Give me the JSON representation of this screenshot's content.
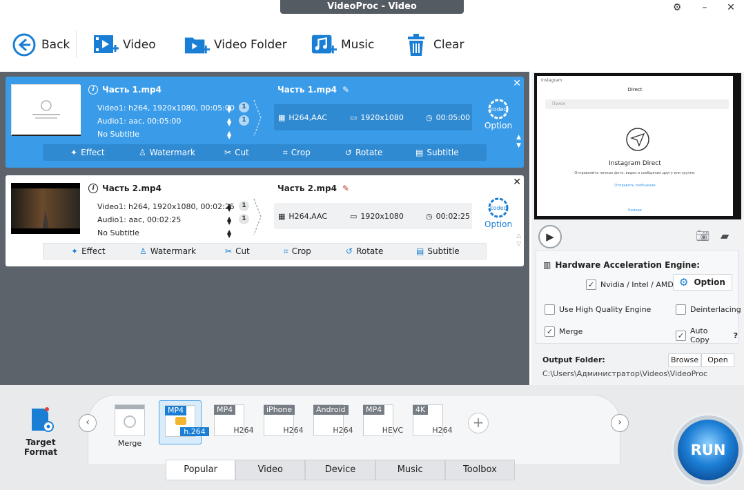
{
  "window": {
    "title": "VideoProc - Video"
  },
  "toolbar": {
    "back": "Back",
    "video": "Video",
    "video_folder": "Video Folder",
    "music": "Music",
    "clear": "Clear"
  },
  "items": [
    {
      "name": "Часть 1.mp4",
      "video_track": "Video1: h264, 1920x1080, 00:05:00",
      "audio_track": "Audio1: aac, 00:05:00",
      "subtitle": "No Subtitle",
      "video_count": "1",
      "audio_count": "1",
      "output_name": "Часть 1.mp4",
      "out_codec": "H264,AAC",
      "out_res": "1920x1080",
      "out_dur": "00:05:00",
      "option": "Option"
    },
    {
      "name": "Часть 2.mp4",
      "video_track": "Video1: h264, 1920x1080, 00:02:25",
      "audio_track": "Audio1: aac, 00:02:25",
      "subtitle": "No Subtitle",
      "video_count": "1",
      "audio_count": "1",
      "output_name": "Часть 2.mp4",
      "out_codec": "H264,AAC",
      "out_res": "1920x1080",
      "out_dur": "00:02:25",
      "option": "Option"
    }
  ],
  "fx": {
    "effect": "Effect",
    "watermark": "Watermark",
    "cut": "Cut",
    "crop": "Crop",
    "rotate": "Rotate",
    "subtitle": "Subtitle"
  },
  "preview": {
    "app": "Instagram",
    "heading": "Direct",
    "search": "Поиск",
    "title": "Instagram Direct",
    "desc": "Отправляйте личные фото, видео и сообщения другу или группе.",
    "link": "Отправить сообщение",
    "camera": "Камера"
  },
  "hw": {
    "title": "Hardware Acceleration Engine:",
    "nvidia": "Nvidia / Intel / AMD",
    "option": "Option",
    "hq": "Use High Quality Engine",
    "deint": "Deinterlacing",
    "merge": "Merge",
    "autocopy": "Auto Copy",
    "help": "?"
  },
  "output": {
    "label": "Output Folder:",
    "browse": "Browse",
    "open": "Open",
    "path": "C:\\Users\\Администратор\\Videos\\VideoProc"
  },
  "bottom": {
    "target": "Target Format",
    "merge": "Merge",
    "formats": [
      {
        "tag": "MP4",
        "label": "h.264"
      },
      {
        "tag": "MP4",
        "label": "H264"
      },
      {
        "tag": "iPhone",
        "label": "H264"
      },
      {
        "tag": "Android",
        "label": "H264"
      },
      {
        "tag": "MP4",
        "label": "HEVC"
      },
      {
        "tag": "4K",
        "label": "H264"
      }
    ],
    "add": "+",
    "tabs": [
      "Popular",
      "Video",
      "Device",
      "Music",
      "Toolbox"
    ],
    "run": "RUN"
  },
  "colors": {
    "accent": "#3a9ce8",
    "dark_bg": "#5d636b",
    "run": "#1d7fd6"
  }
}
